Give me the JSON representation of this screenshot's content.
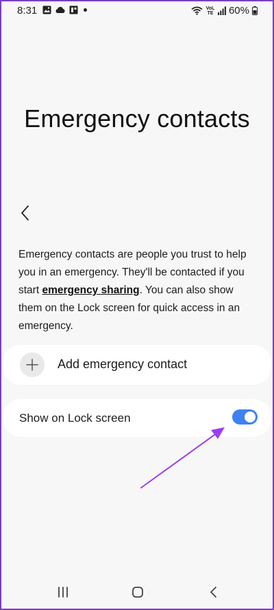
{
  "status_bar": {
    "time": "8:31",
    "battery_percent": "60%",
    "network_label": "VoLTE",
    "icons": [
      "image-icon",
      "cloud-icon",
      "app-icon",
      "wifi-icon",
      "signal-icon",
      "battery-icon"
    ]
  },
  "page": {
    "title": "Emergency contacts"
  },
  "description": {
    "part1": "Emergency contacts are people you trust to help you in an emergency. They'll be contacted if you start ",
    "link": "emergency sharing",
    "part2": ". You can also show them on the Lock screen for quick access in an emergency."
  },
  "add_contact": {
    "label": "Add emergency contact",
    "icon": "plus-icon"
  },
  "lock_screen": {
    "label": "Show on Lock screen",
    "enabled": true
  },
  "colors": {
    "toggle_on": "#3e82f0",
    "annotation_arrow": "#9b3ef0",
    "frame_border": "#7b3fc4"
  },
  "nav_bar": {
    "icons": [
      "recent-apps-icon",
      "home-icon",
      "back-icon"
    ]
  }
}
